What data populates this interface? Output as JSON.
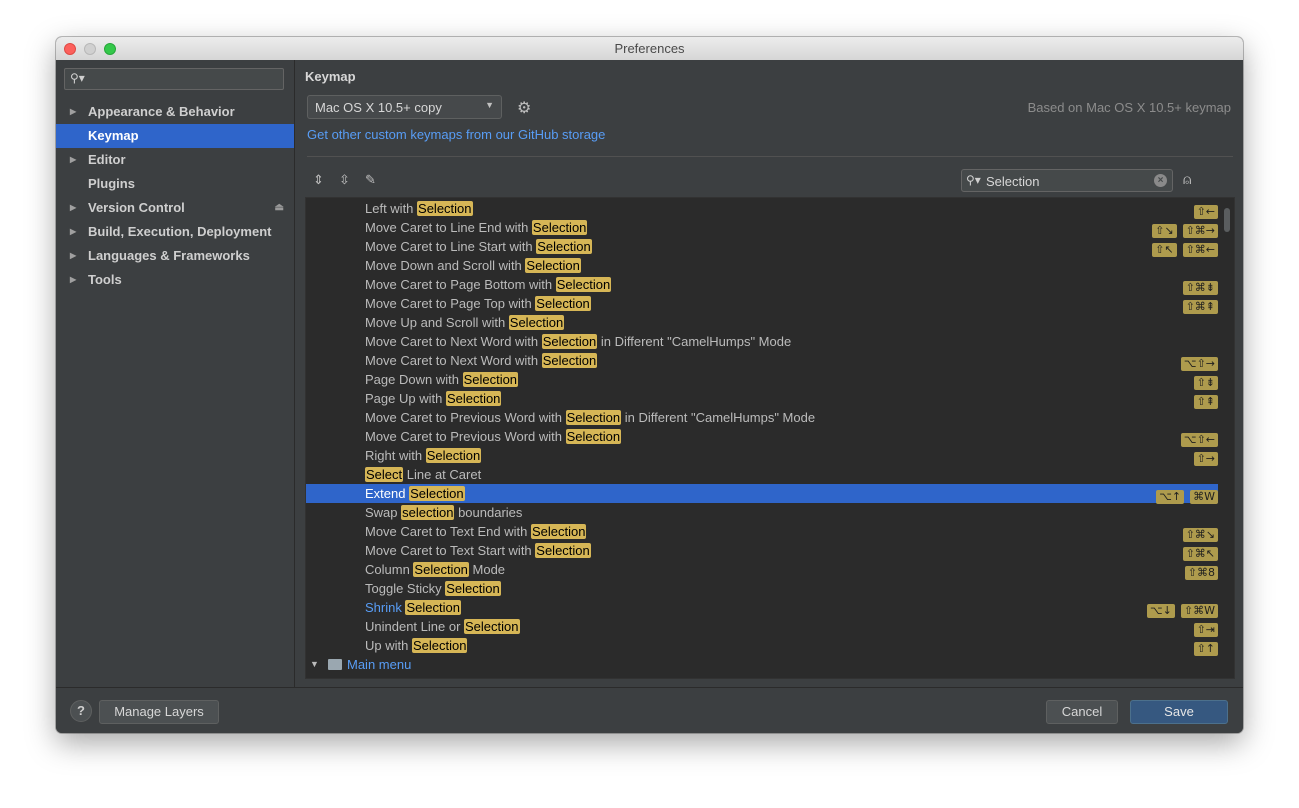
{
  "window": {
    "title": "Preferences"
  },
  "sidebar": {
    "search_placeholder": "",
    "items": [
      {
        "label": "Appearance & Behavior",
        "expandable": true,
        "selected": false
      },
      {
        "label": "Keymap",
        "expandable": false,
        "selected": true
      },
      {
        "label": "Editor",
        "expandable": true,
        "selected": false
      },
      {
        "label": "Plugins",
        "expandable": false,
        "selected": false
      },
      {
        "label": "Version Control",
        "expandable": true,
        "selected": false
      },
      {
        "label": "Build, Execution, Deployment",
        "expandable": true,
        "selected": false
      },
      {
        "label": "Languages & Frameworks",
        "expandable": true,
        "selected": false
      },
      {
        "label": "Tools",
        "expandable": true,
        "selected": false
      }
    ]
  },
  "keymap": {
    "title": "Keymap",
    "scheme": "Mac OS X 10.5+ copy",
    "based_on": "Based on Mac OS X 10.5+ keymap",
    "github_link": "Get other custom keymaps from our GitHub storage",
    "filter_value": "Selection",
    "rows": [
      {
        "pre": "Left with ",
        "hl": "Selection",
        "post": "",
        "keys": [
          "⇧←"
        ]
      },
      {
        "pre": "Move Caret to Line End with ",
        "hl": "Selection",
        "post": "",
        "keys": [
          "⇧↘",
          "⇧⌘→"
        ]
      },
      {
        "pre": "Move Caret to Line Start with ",
        "hl": "Selection",
        "post": "",
        "keys": [
          "⇧↖",
          "⇧⌘←"
        ]
      },
      {
        "pre": "Move Down and Scroll with ",
        "hl": "Selection",
        "post": "",
        "keys": []
      },
      {
        "pre": "Move Caret to Page Bottom with ",
        "hl": "Selection",
        "post": "",
        "keys": [
          "⇧⌘⇟"
        ]
      },
      {
        "pre": "Move Caret to Page Top with ",
        "hl": "Selection",
        "post": "",
        "keys": [
          "⇧⌘⇞"
        ]
      },
      {
        "pre": "Move Up and Scroll with ",
        "hl": "Selection",
        "post": "",
        "keys": []
      },
      {
        "pre": "Move Caret to Next Word with ",
        "hl": "Selection",
        "post": " in Different \"CamelHumps\" Mode",
        "keys": []
      },
      {
        "pre": "Move Caret to Next Word with ",
        "hl": "Selection",
        "post": "",
        "keys": [
          "⌥⇧→"
        ]
      },
      {
        "pre": "Page Down with ",
        "hl": "Selection",
        "post": "",
        "keys": [
          "⇧⇟"
        ]
      },
      {
        "pre": "Page Up with ",
        "hl": "Selection",
        "post": "",
        "keys": [
          "⇧⇞"
        ]
      },
      {
        "pre": "Move Caret to Previous Word with ",
        "hl": "Selection",
        "post": " in Different \"CamelHumps\" Mode",
        "keys": []
      },
      {
        "pre": "Move Caret to Previous Word with ",
        "hl": "Selection",
        "post": "",
        "keys": [
          "⌥⇧←"
        ]
      },
      {
        "pre": "Right with ",
        "hl": "Selection",
        "post": "",
        "keys": [
          "⇧→"
        ]
      },
      {
        "pre": "",
        "hl": "Select",
        "post": " Line at Caret",
        "keys": []
      },
      {
        "pre": "Extend ",
        "hl": "Selection",
        "post": "",
        "keys": [
          "⌥↑",
          "⌘W"
        ],
        "selected": true
      },
      {
        "pre": "Swap ",
        "hl": "selection",
        "post": " boundaries",
        "keys": []
      },
      {
        "pre": "Move Caret to Text End with ",
        "hl": "Selection",
        "post": "",
        "keys": [
          "⇧⌘↘"
        ]
      },
      {
        "pre": "Move Caret to Text Start with ",
        "hl": "Selection",
        "post": "",
        "keys": [
          "⇧⌘↖"
        ]
      },
      {
        "pre": "Column ",
        "hl": "Selection",
        "post": " Mode",
        "keys": [
          "⇧⌘8"
        ]
      },
      {
        "pre": "Toggle Sticky ",
        "hl": "Selection",
        "post": "",
        "keys": []
      },
      {
        "pre": "Shrink ",
        "hl": "Selection",
        "post": "",
        "keys": [
          "⌥↓",
          "⇧⌘W"
        ],
        "link": true
      },
      {
        "pre": "Unindent Line or ",
        "hl": "Selection",
        "post": "",
        "keys": [
          "⇧⇥"
        ]
      },
      {
        "pre": "Up with ",
        "hl": "Selection",
        "post": "",
        "keys": [
          "⇧↑"
        ]
      }
    ],
    "group_label": "Main menu"
  },
  "footer": {
    "help": "?",
    "manage_layers": "Manage Layers",
    "cancel": "Cancel",
    "save": "Save"
  },
  "colors": {
    "accent": "#2f65ca",
    "link": "#589df6",
    "highlight": "#d6b656"
  }
}
